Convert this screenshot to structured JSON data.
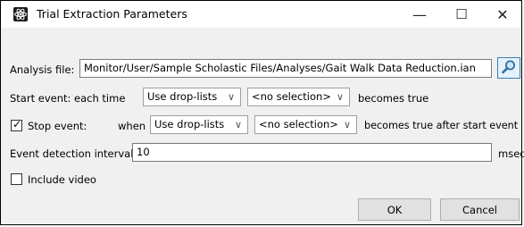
{
  "window": {
    "title": "Trial Extraction Parameters",
    "minimize_glyph": "—",
    "maximize_glyph": "☐",
    "close_glyph": "✕",
    "app_icon": "atom-icon"
  },
  "analysis": {
    "label": "Analysis file:",
    "value": "Monitor/User/Sample Scholastic Files/Analyses/Gait Walk Data Reduction.ian",
    "browse_icon": "magnifier-icon"
  },
  "start_event": {
    "label": "Start event: each time",
    "select1": "Use drop-lists",
    "select2": "<no selection>",
    "suffix": "becomes true"
  },
  "stop_event": {
    "checked": true,
    "label": "Stop event:",
    "when": "when",
    "select1": "Use drop-lists",
    "select2": "<no selection>",
    "suffix": "becomes true after start event"
  },
  "detection": {
    "label": "Event detection interval:",
    "value": "10",
    "unit": "msec"
  },
  "include_video": {
    "checked": false,
    "label": "Include video"
  },
  "buttons": {
    "ok": "OK",
    "cancel": "Cancel"
  },
  "colors": {
    "title_bg": "#ffffff",
    "body_bg": "#f0f0f0",
    "button_bg": "#e1e1e1",
    "accent": "#3c7fb1"
  }
}
